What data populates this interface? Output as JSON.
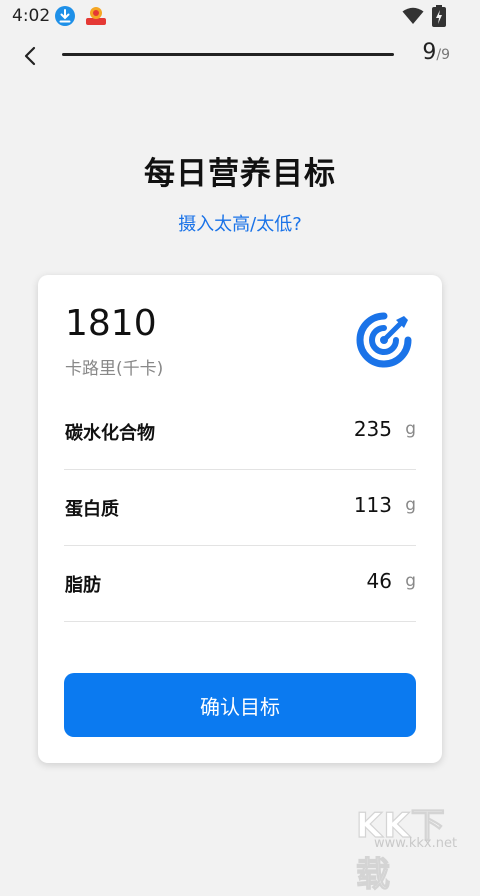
{
  "status_bar": {
    "time": "4:02"
  },
  "nav": {
    "step_current": "9",
    "step_total": "/9"
  },
  "header": {
    "title": "每日营养目标",
    "help_link": "摄入太高/太低?"
  },
  "card": {
    "calories": "1810",
    "calories_unit": "卡路里(千卡)",
    "macros": [
      {
        "label": "碳水化合物",
        "value": "235",
        "unit": "g"
      },
      {
        "label": "蛋白质",
        "value": "113",
        "unit": "g"
      },
      {
        "label": "脂肪",
        "value": "46",
        "unit": "g"
      }
    ],
    "confirm_label": "确认目标"
  },
  "watermark": {
    "text": "KK下载",
    "url": "www.kkx.net"
  },
  "colors": {
    "accent": "#0b7af0",
    "link": "#1a73e8",
    "background": "#f2f2f2"
  }
}
